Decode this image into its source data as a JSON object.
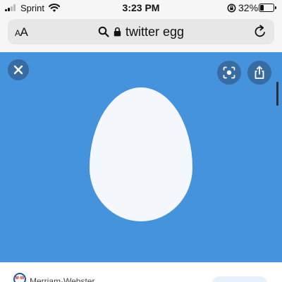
{
  "status_bar": {
    "carrier": "Sprint",
    "time": "3:23 PM",
    "battery_percent_label": "32%",
    "battery_level": 0.32,
    "signal_bars_filled": 2,
    "signal_bars_total": 4
  },
  "address_bar": {
    "text_size_button": "AA",
    "url": "twitter egg"
  },
  "viewer": {
    "background_color": "#4593dc",
    "egg_color": "#f4f7fb"
  },
  "source": {
    "name": "Merriam-Webster",
    "logo_text": "M-W"
  },
  "icons": {
    "signal": "cellular-signal-icon",
    "wifi": "wifi-icon",
    "rotation_lock": "rotation-lock-icon",
    "battery": "battery-icon",
    "search": "search-icon",
    "lock": "lock-icon",
    "reload": "reload-icon",
    "close": "close-icon",
    "lens": "lens-search-icon",
    "share": "share-icon"
  }
}
